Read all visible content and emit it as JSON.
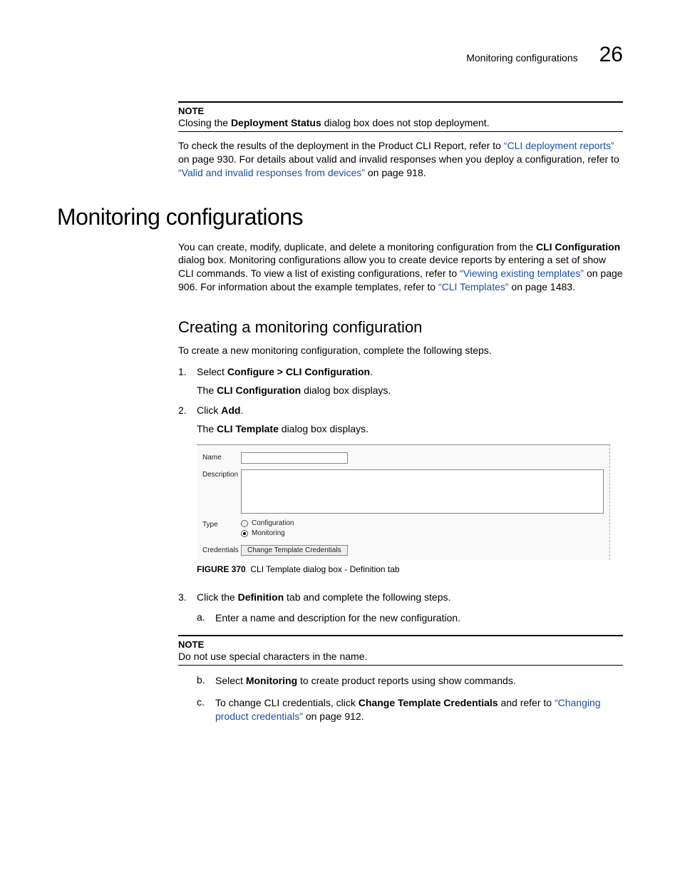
{
  "header": {
    "title": "Monitoring configurations",
    "chapter": "26"
  },
  "noteA": {
    "label": "NOTE",
    "pre": "Closing the ",
    "bold": "Deployment Status",
    "post": " dialog box does not stop deployment."
  },
  "paraA": {
    "t1": "To check the results of the deployment in the Product CLI Report, refer to ",
    "l1": "“CLI deployment reports”",
    "t2": " on page 930. For details about valid and invalid responses when you deploy a configuration, refer to ",
    "l2": "“Valid and invalid responses from devices”",
    "t3": " on page 918."
  },
  "h1": "Monitoring configurations",
  "paraB": {
    "t1": "You can create, modify, duplicate, and delete a monitoring configuration from the ",
    "b1": "CLI Configuration",
    "t2": " dialog box. Monitoring configurations allow you to create device reports by entering a set of show CLI commands. To view a list of existing configurations, refer to ",
    "l1": "“Viewing existing templates”",
    "t3": " on page 906. For information about the example templates, refer to ",
    "l2": "“CLI Templates”",
    "t4": " on page 1483."
  },
  "h2": "Creating a monitoring configuration",
  "paraC": "To create a new monitoring configuration, complete the following steps.",
  "steps": {
    "s1": {
      "num": "1.",
      "pre": "Select ",
      "bold": "Configure > CLI Configuration",
      "post": ".",
      "sub_pre": "The ",
      "sub_bold": "CLI Configuration",
      "sub_post": " dialog box displays."
    },
    "s2": {
      "num": "2.",
      "pre": "Click ",
      "bold": "Add",
      "post": ".",
      "sub_pre": "The ",
      "sub_bold": "CLI Template",
      "sub_post": " dialog box displays."
    },
    "s3": {
      "num": "3.",
      "pre": "Click the ",
      "bold": "Definition",
      "post": " tab and complete the following steps."
    }
  },
  "dialog": {
    "name": "Name",
    "description": "Description",
    "type": "Type",
    "opt1": "Configuration",
    "opt2": "Monitoring",
    "credentials": "Credentials",
    "button": "Change Template Credentials"
  },
  "figure": {
    "label": "FIGURE 370",
    "caption": "CLI Template dialog box - Definition tab"
  },
  "substeps": {
    "a": {
      "letter": "a.",
      "text": "Enter a name and description for the new configuration."
    },
    "b": {
      "letter": "b.",
      "pre": "Select ",
      "bold": "Monitoring",
      "post": " to create product reports using show commands."
    },
    "c": {
      "letter": "c.",
      "pre": "To change CLI credentials, click ",
      "bold": "Change Template Credentials",
      "mid": " and refer to ",
      "link": "“Changing product credentials”",
      "post": " on page 912."
    }
  },
  "noteB": {
    "label": "NOTE",
    "text": "Do not use special characters in the name."
  }
}
